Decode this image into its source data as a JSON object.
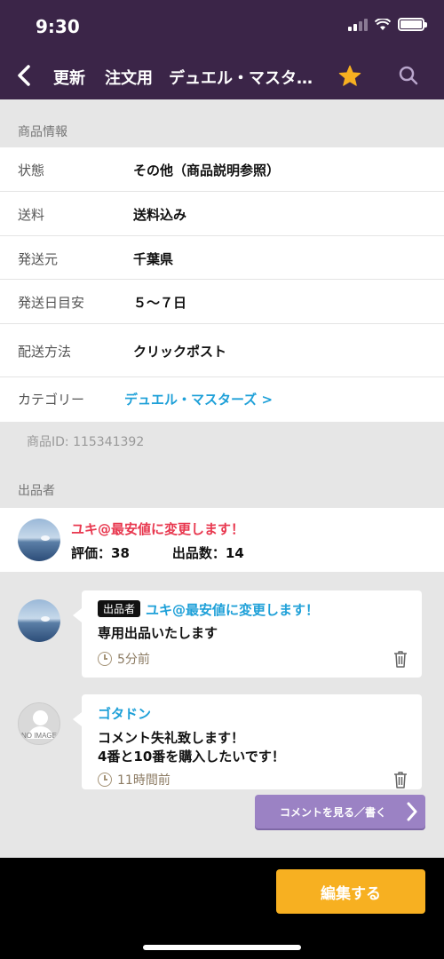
{
  "status_bar": {
    "time": "9:30"
  },
  "nav": {
    "update_label": "更新",
    "title": "注文用　デュエル・マスターズ",
    "icons": {
      "back": "chevron-left-icon",
      "favorite": "star-icon",
      "search": "search-icon"
    },
    "star_color": "#f7b021"
  },
  "product_info": {
    "header": "商品情報",
    "rows": [
      {
        "label": "状態",
        "value": "その他（商品説明参照）"
      },
      {
        "label": "送料",
        "value": "送料込み"
      },
      {
        "label": "発送元",
        "value": "千葉県"
      },
      {
        "label": "発送日目安",
        "value": "５〜７日"
      },
      {
        "label": "配送方法",
        "value": "クリックポスト"
      },
      {
        "label": "カテゴリー",
        "value": "デュエル・マスターズ >"
      }
    ],
    "product_id": "商品ID:   115341392"
  },
  "seller": {
    "header": "出品者",
    "name": "ユキ@最安値に変更します！",
    "rating_label": "評価：",
    "rating": "38",
    "listings_label": "出品数：",
    "listings": "14"
  },
  "comments": [
    {
      "tag": "出品者",
      "name": "ユキ@最安値に変更します！",
      "text": "専用出品いたします",
      "time": "5分前"
    },
    {
      "name": "ゴタドン",
      "avatar_text": "NO IMAGE",
      "text_lines": [
        "コメント失礼致します！",
        "4番と10番を購入したいです！"
      ],
      "time": "11時間前"
    }
  ],
  "view_comments_label": "コメントを見る／書く",
  "edit_label": "編集する",
  "colors": {
    "header_bg": "#3b2548",
    "accent_link": "#1ea0d8",
    "seller_name": "#e8384f",
    "edit_button": "#f7b021",
    "comments_button": "#9b82c4"
  }
}
